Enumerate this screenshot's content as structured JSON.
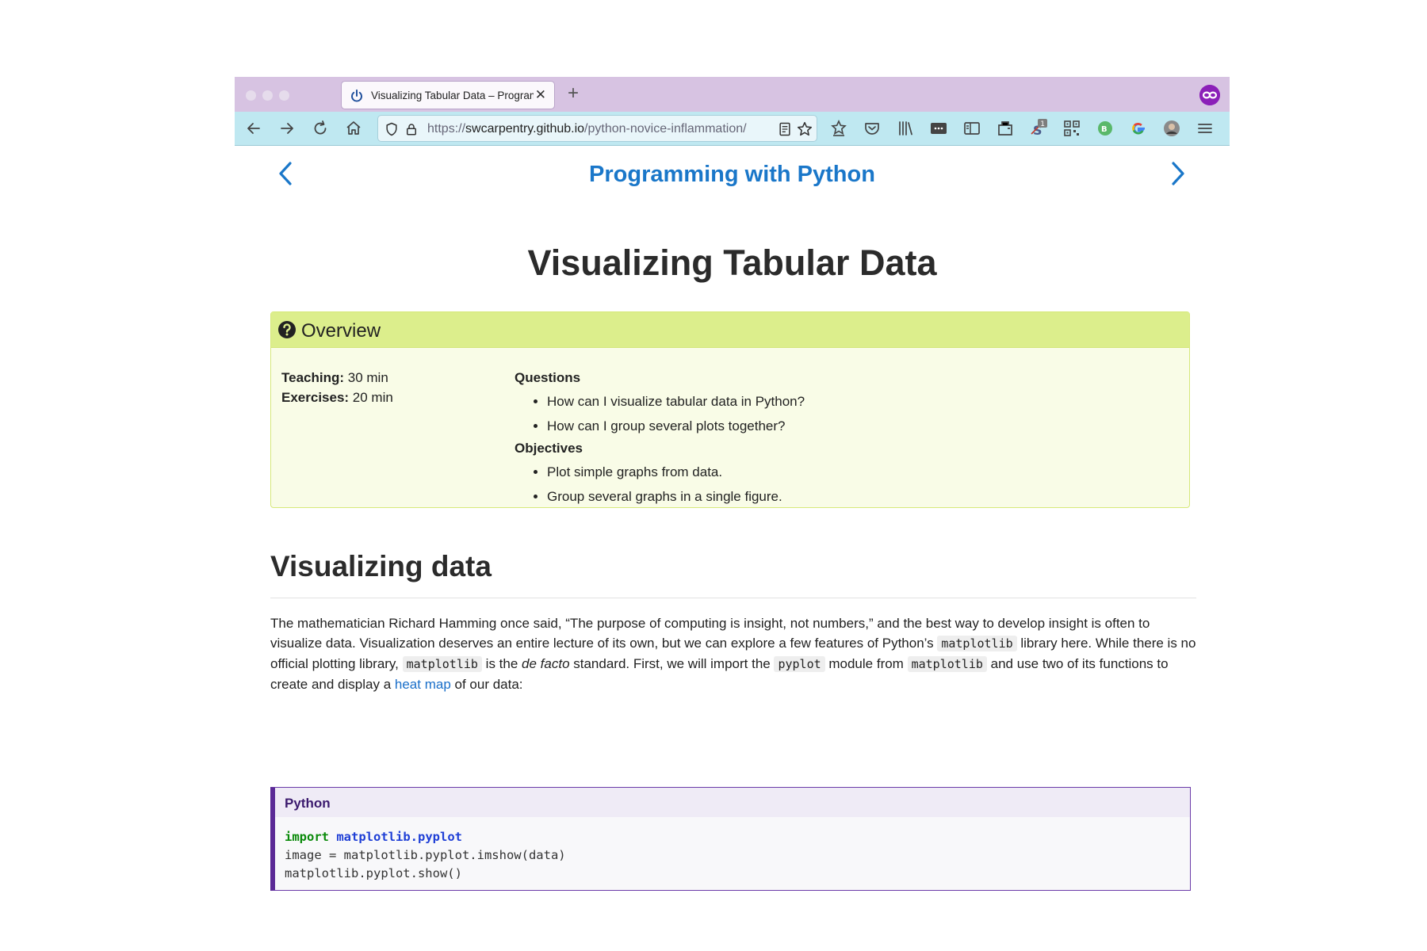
{
  "browser": {
    "tab_title": "Visualizing Tabular Data – Programming with Python",
    "url_prefix": "https://",
    "url_host": "swcarpentry.github.io",
    "url_path": "/python-novice-inflammation/",
    "extension_badge": "1",
    "accent_color": "#d7c3e2",
    "toolbar_color": "#bfe8f1"
  },
  "site": {
    "title": "Programming with Python"
  },
  "page": {
    "title": "Visualizing Tabular Data"
  },
  "overview": {
    "heading": "Overview",
    "teaching_label": "Teaching:",
    "teaching_value": " 30 min",
    "exercises_label": "Exercises:",
    "exercises_value": " 20 min",
    "questions_heading": "Questions",
    "questions": [
      "How can I visualize tabular data in Python?",
      "How can I group several plots together?"
    ],
    "objectives_heading": "Objectives",
    "objectives": [
      "Plot simple graphs from data.",
      "Group several graphs in a single figure."
    ]
  },
  "section": {
    "heading": "Visualizing data",
    "p1": "The mathematician Richard Hamming once said, “The purpose of computing is insight, not numbers,” and the best way to develop insight is often to visualize data. Visualization deserves an entire lecture of its own, but we can explore a few features of Python’s ",
    "code1": "matplotlib",
    "p2": " library here. While there is no official plotting library, ",
    "code2": "matplotlib",
    "p3": " is the ",
    "em": "de facto",
    "p4": " standard. First, we will import the ",
    "code3": "pyplot",
    "p5": " module from ",
    "code4": "matplotlib",
    "p6": " and use two of its functions to create and display a ",
    "link": "heat map",
    "p7": " of our data:"
  },
  "codeblock": {
    "language": "Python",
    "kw_import": "import",
    "module": "matplotlib.pyplot",
    "line2": "image = matplotlib.pyplot.imshow(data)",
    "line3": "matplotlib.pyplot.show()"
  }
}
